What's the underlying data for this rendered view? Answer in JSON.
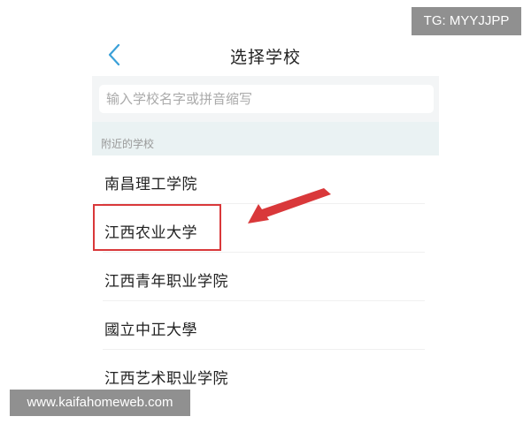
{
  "header": {
    "title": "选择学校",
    "back_icon": "chevron-left-icon"
  },
  "search": {
    "placeholder": "输入学校名字或拼音缩写",
    "value": ""
  },
  "nearby": {
    "section_label": "附近的学校",
    "schools": [
      {
        "name": "南昌理工学院"
      },
      {
        "name": "江西农业大学"
      },
      {
        "name": "江西青年职业学院"
      },
      {
        "name": "國立中正大學"
      },
      {
        "name": "江西艺术职业学院"
      }
    ]
  },
  "annotation": {
    "highlighted_school_index": 1,
    "color": "#d9383a"
  },
  "watermarks": {
    "top_right": "TG: MYYJJPP",
    "bottom_left": "www.kaifahomeweb.com"
  },
  "colors": {
    "accent": "#3aa0d8",
    "section_bg": "#eaf2f3",
    "search_bg": "#f3f5f6"
  }
}
